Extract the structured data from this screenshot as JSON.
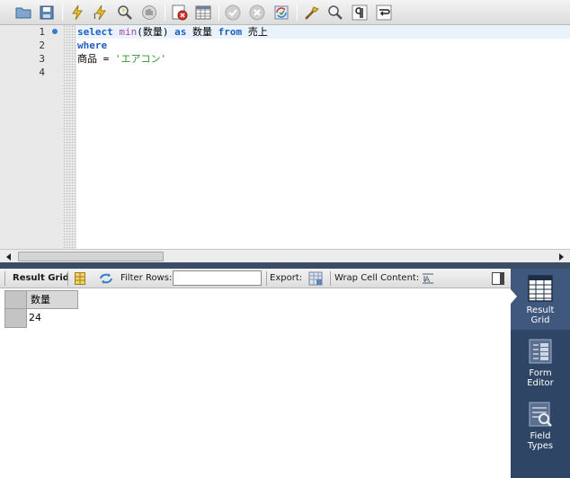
{
  "toolbar": {
    "icons": [
      "open-folder-icon",
      "save-icon",
      "execute-icon",
      "execute-current-icon",
      "explain-icon",
      "stop-icon",
      "toggle-error-icon",
      "toggle-results-icon",
      "commit-icon",
      "rollback-icon",
      "autocommit-icon",
      "beautify-icon",
      "find-icon",
      "invisible-chars-icon",
      "word-wrap-icon"
    ]
  },
  "editor": {
    "line_numbers": [
      "1",
      "2",
      "3",
      "4"
    ],
    "lines": [
      [
        {
          "t": "select",
          "c": "kw"
        },
        {
          "t": " ",
          "c": ""
        },
        {
          "t": "min",
          "c": "fn"
        },
        {
          "t": "(数量) ",
          "c": ""
        },
        {
          "t": "as",
          "c": "kw"
        },
        {
          "t": " 数量 ",
          "c": ""
        },
        {
          "t": "from",
          "c": "kw"
        },
        {
          "t": " 売上",
          "c": ""
        }
      ],
      [
        {
          "t": "where",
          "c": "kw"
        }
      ],
      [
        {
          "t": "商品 = ",
          "c": ""
        },
        {
          "t": "'エアコン'",
          "c": "str"
        }
      ],
      []
    ]
  },
  "result_toolbar": {
    "result_grid_label": "Result Grid",
    "filter_rows_label": "Filter Rows:",
    "filter_value": "",
    "export_label": "Export:",
    "wrap_label": "Wrap Cell Content:"
  },
  "grid": {
    "columns": [
      "数量"
    ],
    "rows": [
      [
        "24"
      ]
    ]
  },
  "side_panel": {
    "items": [
      {
        "line1": "Result",
        "line2": "Grid"
      },
      {
        "line1": "Form",
        "line2": "Editor"
      },
      {
        "line1": "Field",
        "line2": "Types"
      }
    ]
  }
}
